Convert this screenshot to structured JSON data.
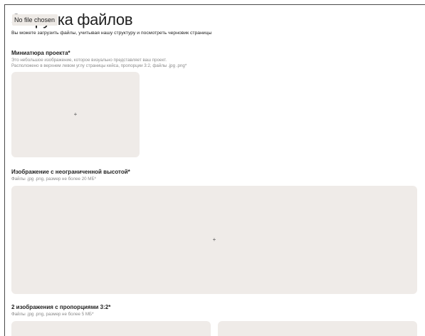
{
  "upload": {
    "file_input_status": "No file chosen",
    "title": "Загрузка файлов",
    "subtitle": "Вы можете загрузить файлы, учитывая нашу структуру и посмотреть черновик страницы"
  },
  "sections": [
    {
      "title": "Миниатюра проекта*",
      "hint_lines": [
        "Это небольшое изображение, которое визуально представляет ваш проект.",
        "Расположено в верхнем левом углу страницы кейса, пропорции 3:2, файлы .jpg .png*"
      ],
      "drop_icon": "+"
    },
    {
      "title": "Изображение с неограниченной высотой*",
      "hint_lines": [
        "Файлы .jpg .png, размер не более 20 МБ*"
      ],
      "drop_icon": "+"
    },
    {
      "title": "2 изображения с пропорциями 3:2*",
      "hint_lines": [
        "Файлы .jpg .png, размер не более 5 МБ*"
      ]
    }
  ]
}
